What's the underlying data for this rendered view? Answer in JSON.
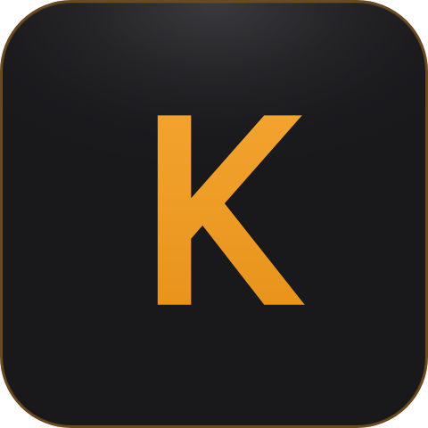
{
  "app_icon": {
    "letter": "K",
    "letter_color_top": "#f2a32e",
    "letter_color_bottom": "#e8941c",
    "background_color": "#1c1c1f",
    "border_color": "#6b4a1f"
  }
}
